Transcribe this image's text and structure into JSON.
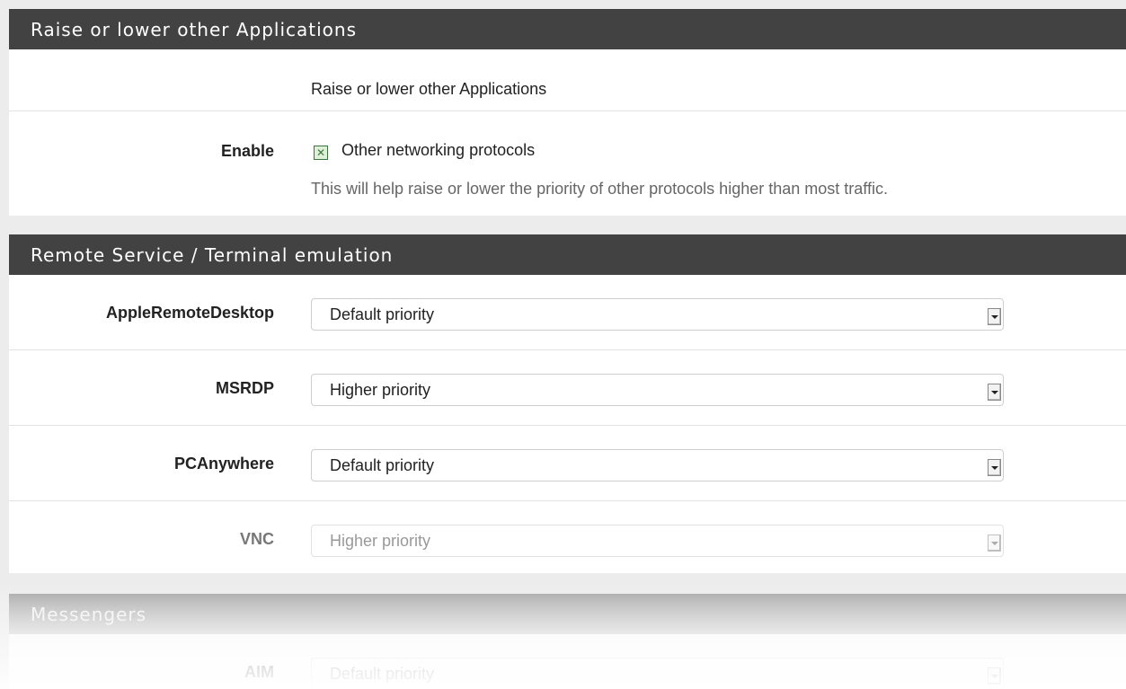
{
  "sections": {
    "raise_lower": {
      "title": "Raise or lower other Applications",
      "description": "Raise or lower other Applications",
      "enable": {
        "label": "Enable",
        "checkbox_label": "Other networking protocols",
        "checked": true,
        "help": "This will help raise or lower the priority of other protocols higher than most traffic."
      }
    },
    "remote": {
      "title": "Remote Service / Terminal emulation",
      "rows": [
        {
          "label": "AppleRemoteDesktop",
          "value": "Default priority"
        },
        {
          "label": "MSRDP",
          "value": "Higher priority"
        },
        {
          "label": "PCAnywhere",
          "value": "Default priority"
        },
        {
          "label": "VNC",
          "value": "Higher priority"
        }
      ]
    },
    "messengers": {
      "title": "Messengers",
      "rows": [
        {
          "label": "AIM",
          "value": "Default priority"
        }
      ]
    }
  },
  "colors": {
    "heading_bg": "#424242",
    "checkbox_green": "#3c763d",
    "page_bg": "#ececec"
  }
}
